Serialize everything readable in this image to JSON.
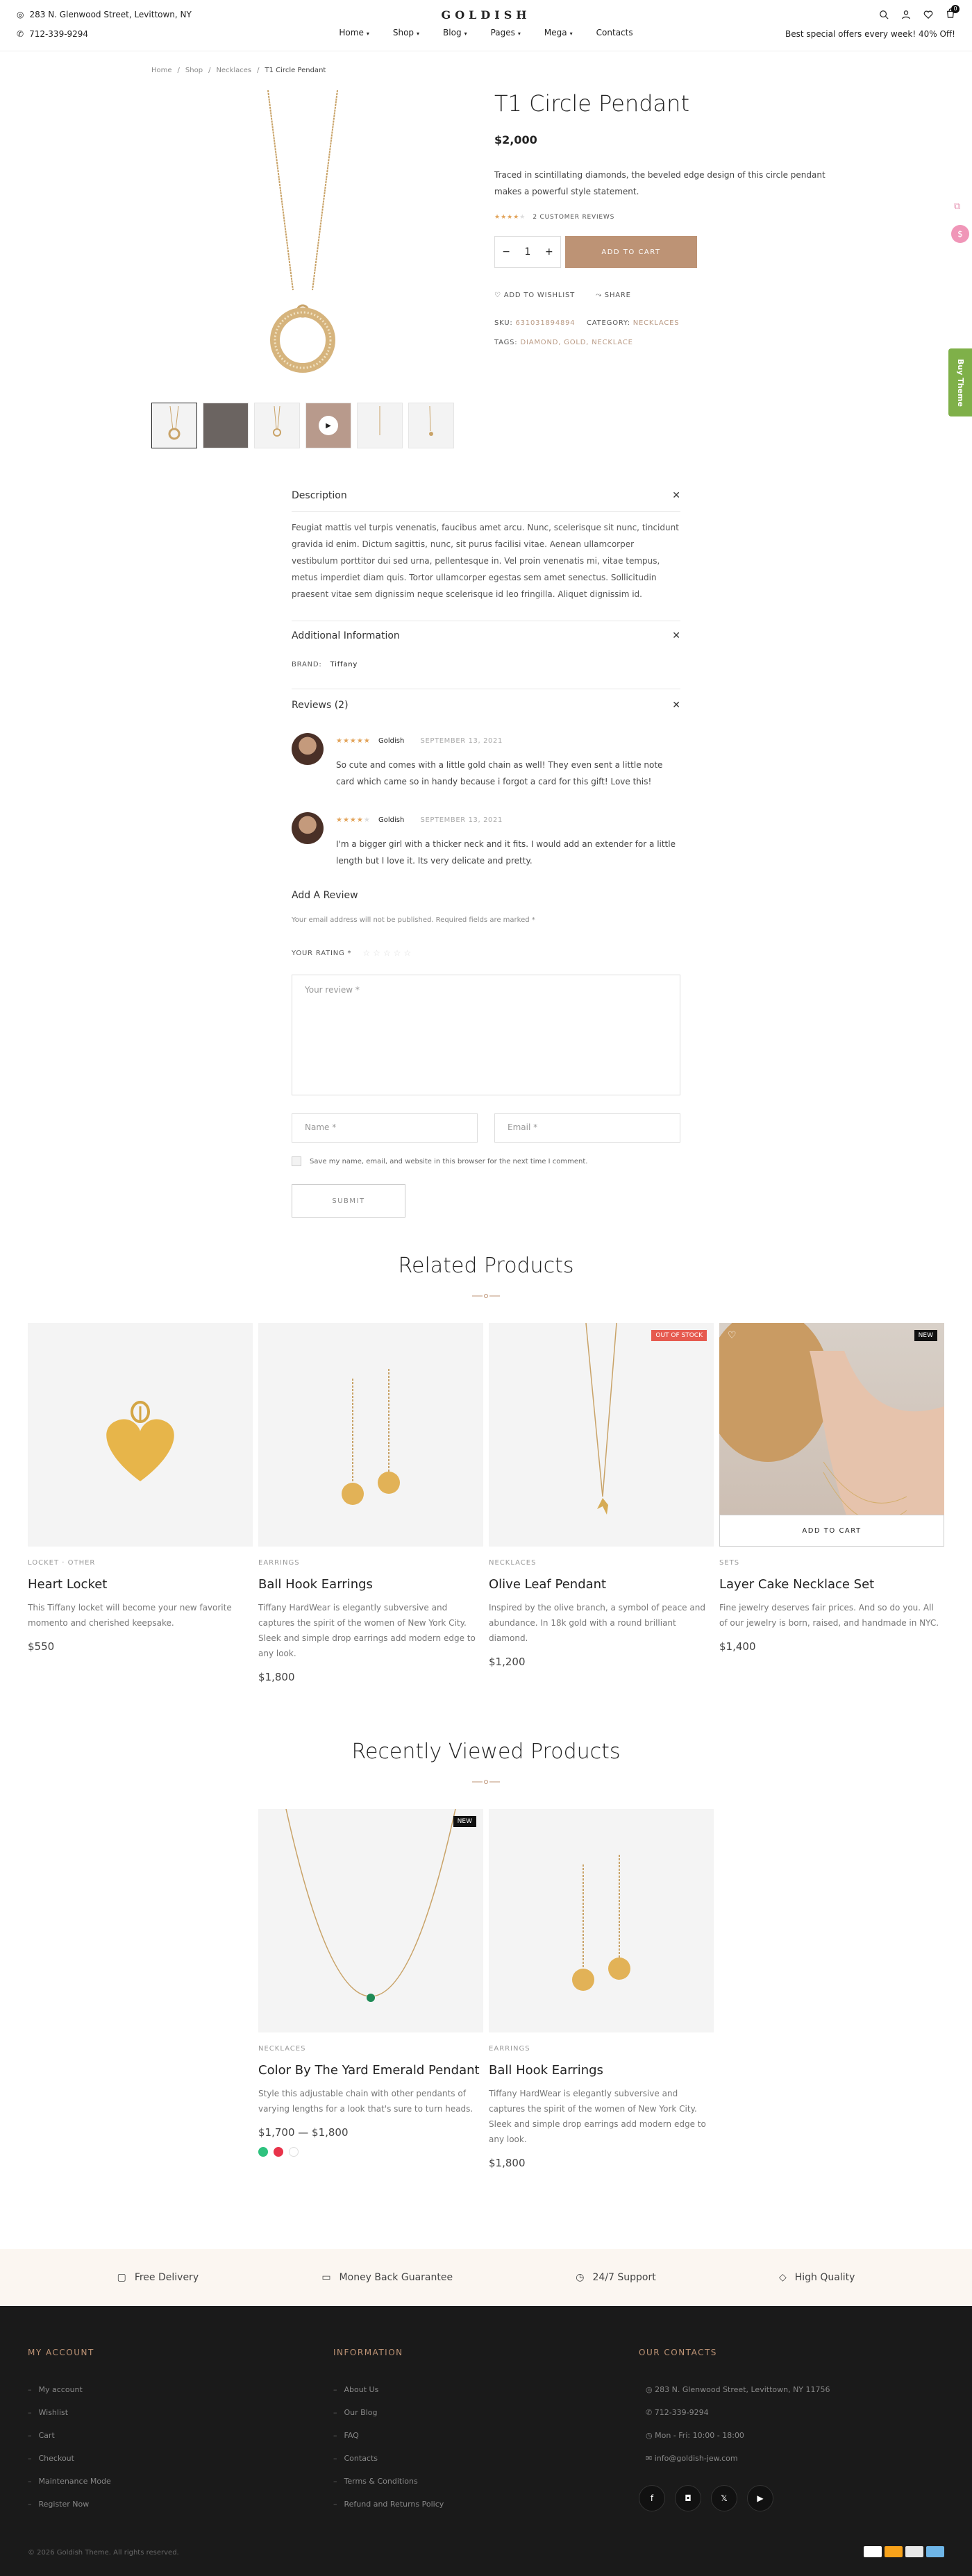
{
  "header": {
    "address": "283 N. Glenwood Street, Levittown, NY",
    "phone": "712-339-9294",
    "logo": "GOLDISH",
    "nav": [
      "Home",
      "Shop",
      "Blog",
      "Pages",
      "Mega",
      "Contacts"
    ],
    "offer": "Best special offers every week! 40% Off!",
    "cart_count": "0"
  },
  "breadcrumb": [
    "Home",
    "Shop",
    "Necklaces",
    "T1 Circle Pendant"
  ],
  "product": {
    "title": "T1 Circle Pendant",
    "price": "$2,000",
    "description": "Traced in scintillating diamonds, the beveled edge design of this circle pendant makes a powerful style statement.",
    "rating": 4,
    "reviews_label": "2 CUSTOMER REVIEWS",
    "quantity": "1",
    "add_to_cart": "ADD TO CART",
    "wishlist": "ADD TO WISHLIST",
    "share": "SHARE",
    "sku_label": "SKU:",
    "sku": "631031894894",
    "category_label": "CATEGORY:",
    "category": "NECKLACES",
    "tags_label": "TAGS:",
    "tags": "DIAMOND, GOLD, NECKLACE"
  },
  "tabs": {
    "description_title": "Description",
    "description_text": "Feugiat mattis vel turpis venenatis, faucibus amet arcu. Nunc, scelerisque sit nunc, tincidunt gravida id enim. Dictum sagittis, nunc, sit purus facilisi vitae. Aenean ullamcorper vestibulum porttitor dui sed urna, pellentesque in. Vel proin venenatis mi, vitae tempus, metus imperdiet diam quis. Tortor ullamcorper egestas sem amet senectus. Sollicitudin praesent vitae sem dignissim neque scelerisque id leo fringilla. Aliquet dignissim id.",
    "additional_title": "Additional Information",
    "brand_label": "BRAND:",
    "brand": "Tiffany",
    "reviews_title": "Reviews (2)"
  },
  "reviews": [
    {
      "author": "Goldish",
      "date": "SEPTEMBER 13, 2021",
      "rating": 5,
      "text": "So cute and comes with a little gold chain as well! They even sent a little note card which came so in handy because i forgot a card for this gift! Love this!"
    },
    {
      "author": "Goldish",
      "date": "SEPTEMBER 13, 2021",
      "rating": 4,
      "text": "I'm a bigger girl with a thicker neck and it fits. I would add an extender for a little length but I love it. Its very delicate and pretty."
    }
  ],
  "review_form": {
    "title": "Add A Review",
    "note": "Your email address will not be published. Required fields are marked *",
    "rating_label": "YOUR RATING *",
    "review_placeholder": "Your review *",
    "name_placeholder": "Name *",
    "email_placeholder": "Email *",
    "consent": "Save my name, email, and website in this browser for the next time I comment.",
    "submit": "SUBMIT"
  },
  "related": {
    "title": "Related Products",
    "items": [
      {
        "category": "LOCKET · OTHER",
        "name": "Heart Locket",
        "desc": "This Tiffany locket will become your new favorite momento and cherished keepsake.",
        "price": "$550"
      },
      {
        "category": "EARRINGS",
        "name": "Ball Hook Earrings",
        "desc": "Tiffany HardWear is elegantly subversive and captures the spirit of the women of New York City. Sleek and simple drop earrings add modern edge to any look.",
        "price": "$1,800"
      },
      {
        "category": "NECKLACES",
        "name": "Olive Leaf Pendant",
        "desc": "Inspired by the olive branch, a symbol of peace and abundance. In 18k gold with a round brilliant diamond.",
        "price": "$1,200",
        "badge": "OUT OF STOCK"
      },
      {
        "category": "SETS",
        "name": "Layer Cake Necklace Set",
        "desc": "Fine jewelry deserves fair prices. And so do you. All of our jewelry is born, raised, and handmade in NYC.",
        "price": "$1,400",
        "badge": "NEW",
        "button": "ADD TO CART"
      }
    ]
  },
  "recent": {
    "title": "Recently Viewed Products",
    "items": [
      {
        "category": "NECKLACES",
        "name": "Color By The Yard Emerald Pendant",
        "desc": "Style this adjustable chain with other pendants of varying lengths for a look that's sure to turn heads.",
        "price": "$1,700 — $1,800",
        "badge": "NEW"
      },
      {
        "category": "EARRINGS",
        "name": "Ball Hook Earrings",
        "desc": "Tiffany HardWear is elegantly subversive and captures the spirit of the women of New York City. Sleek and simple drop earrings add modern edge to any look.",
        "price": "$1,800"
      }
    ]
  },
  "features": [
    "Free Delivery",
    "Money Back Guarantee",
    "24/7 Support",
    "High Quality"
  ],
  "footer": {
    "account_title": "MY ACCOUNT",
    "account_links": [
      "My account",
      "Wishlist",
      "Cart",
      "Checkout",
      "Maintenance Mode",
      "Register Now"
    ],
    "info_title": "INFORMATION",
    "info_links": [
      "About Us",
      "Our Blog",
      "FAQ",
      "Contacts",
      "Terms & Conditions",
      "Refund and Returns Policy"
    ],
    "contacts_title": "OUR CONTACTS",
    "contacts": [
      "283 N. Glenwood Street, Levittown, NY 11756",
      "712-339-9294",
      "Mon - Fri: 10:00 - 18:00",
      "info@goldish-jew.com"
    ],
    "copyright": "© 2026 Goldish Theme. All rights reserved."
  },
  "side_tab": "Buy Theme",
  "colors": {
    "accent": "#bd9375",
    "footer_bg": "#1a1a1a",
    "feature_bg": "#fbf6f1",
    "side_tab": "#7fb049"
  }
}
